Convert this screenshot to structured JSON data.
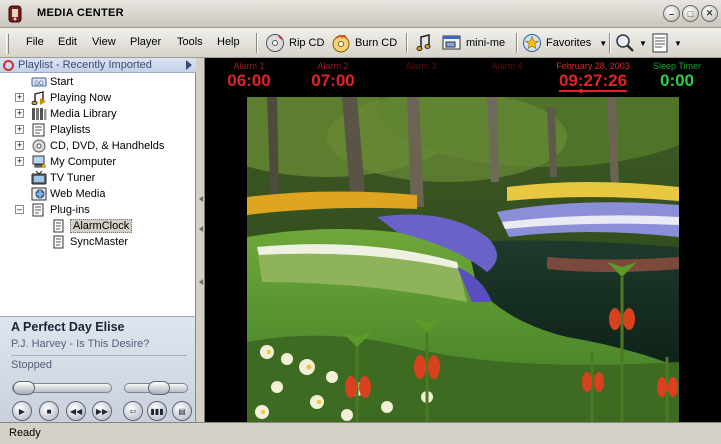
{
  "window": {
    "title": "MEDIA CENTER"
  },
  "menus": [
    "File",
    "Edit",
    "View",
    "Player",
    "Tools",
    "Help"
  ],
  "toolbar": {
    "rip_cd": "Rip CD",
    "burn_cd": "Burn CD",
    "mini_me": "mini-me",
    "favorites": "Favorites"
  },
  "playlist_header": "Playlist - Recently Imported",
  "tree": [
    {
      "label": "Start"
    },
    {
      "label": "Playing Now"
    },
    {
      "label": "Media Library"
    },
    {
      "label": "Playlists"
    },
    {
      "label": "CD, DVD, & Handhelds"
    },
    {
      "label": "My Computer"
    },
    {
      "label": "TV Tuner"
    },
    {
      "label": "Web Media"
    },
    {
      "label": "Plug-ins"
    },
    {
      "label": "AlarmClock",
      "selected": true
    },
    {
      "label": "SyncMaster"
    }
  ],
  "now_playing": {
    "title": "A Perfect Day Elise",
    "artist_album": "P.J. Harvey - Is This Desire?",
    "status": "Stopped"
  },
  "alarm_clock": {
    "alarm1": {
      "label": "Alarm 1",
      "time": "06:00"
    },
    "alarm2": {
      "label": "Alarm 2",
      "time": "07:00"
    },
    "alarm3": {
      "label": "Alarm 3"
    },
    "alarm4": {
      "label": "Alarm 4"
    },
    "current": {
      "date": "February 28, 2003",
      "time": "09:27:26"
    },
    "sleep_timer": {
      "label": "Sleep Timer",
      "time": "0:00"
    }
  },
  "status_bar": {
    "text": "Ready"
  },
  "colors": {
    "alarm_red": "#e02424",
    "sleep_green": "#2ecf4a",
    "panel_bg": "#d4d0c8",
    "header_blue": "#3a4a74"
  }
}
